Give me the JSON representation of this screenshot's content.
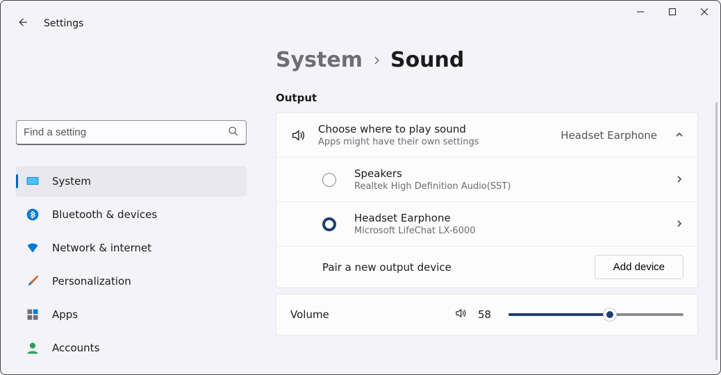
{
  "app": {
    "title": "Settings"
  },
  "search": {
    "placeholder": "Find a setting"
  },
  "sidebar": {
    "items": [
      {
        "label": "System"
      },
      {
        "label": "Bluetooth & devices"
      },
      {
        "label": "Network & internet"
      },
      {
        "label": "Personalization"
      },
      {
        "label": "Apps"
      },
      {
        "label": "Accounts"
      }
    ]
  },
  "breadcrumb": {
    "parent": "System",
    "current": "Sound"
  },
  "output": {
    "section_title": "Output",
    "choose_title": "Choose where to play sound",
    "choose_sub": "Apps might have their own settings",
    "selected_value": "Headset Earphone",
    "devices": [
      {
        "name": "Speakers",
        "sub": "Realtek High Definition Audio(SST)",
        "selected": false
      },
      {
        "name": "Headset Earphone",
        "sub": "Microsoft LifeChat LX-6000",
        "selected": true
      }
    ],
    "pair_label": "Pair a new output device",
    "add_button": "Add device"
  },
  "volume": {
    "label": "Volume",
    "value": "58",
    "percent": 58
  }
}
